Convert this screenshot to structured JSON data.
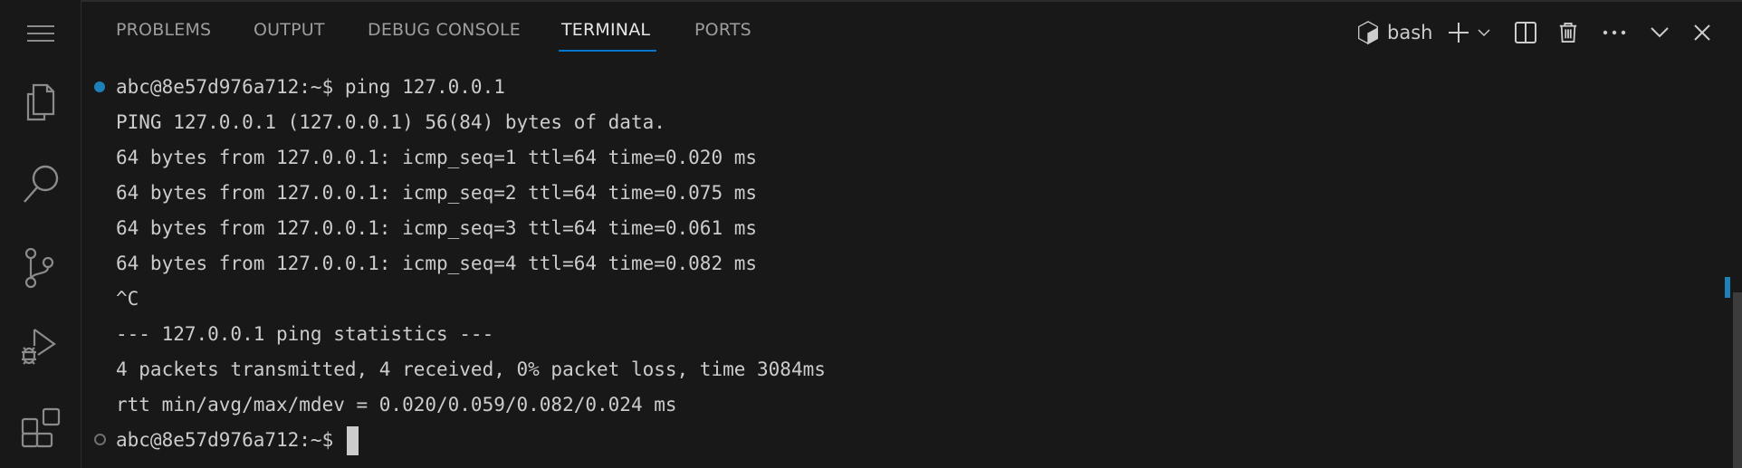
{
  "panel": {
    "tabs": [
      {
        "label": "PROBLEMS",
        "active": false
      },
      {
        "label": "OUTPUT",
        "active": false
      },
      {
        "label": "DEBUG CONSOLE",
        "active": false
      },
      {
        "label": "TERMINAL",
        "active": true
      },
      {
        "label": "PORTS",
        "active": false
      }
    ],
    "terminal_name": "bash",
    "actions": [
      "new-terminal-icon",
      "launch-profile-chevron-icon",
      "split-terminal-icon",
      "kill-terminal-icon",
      "more-actions-icon",
      "collapse-panel-icon",
      "close-panel-icon"
    ]
  },
  "activity_bar": [
    "explorer-icon",
    "search-icon",
    "source-control-icon",
    "run-debug-icon",
    "extensions-icon"
  ],
  "terminal": {
    "lines": [
      "abc@8e57d976a712:~$ ping 127.0.0.1",
      "PING 127.0.0.1 (127.0.0.1) 56(84) bytes of data.",
      "64 bytes from 127.0.0.1: icmp_seq=1 ttl=64 time=0.020 ms",
      "64 bytes from 127.0.0.1: icmp_seq=2 ttl=64 time=0.075 ms",
      "64 bytes from 127.0.0.1: icmp_seq=3 ttl=64 time=0.061 ms",
      "64 bytes from 127.0.0.1: icmp_seq=4 ttl=64 time=0.082 ms",
      "^C",
      "--- 127.0.0.1 ping statistics ---",
      "4 packets transmitted, 4 received, 0% packet loss, time 3084ms",
      "rtt min/avg/max/mdev = 0.020/0.059/0.082/0.024 ms"
    ],
    "prompt": "abc@8e57d976a712:~$ "
  },
  "colors": {
    "accent": "#0078d4",
    "command_success_dot": "#1b81b8",
    "background": "#181818"
  }
}
